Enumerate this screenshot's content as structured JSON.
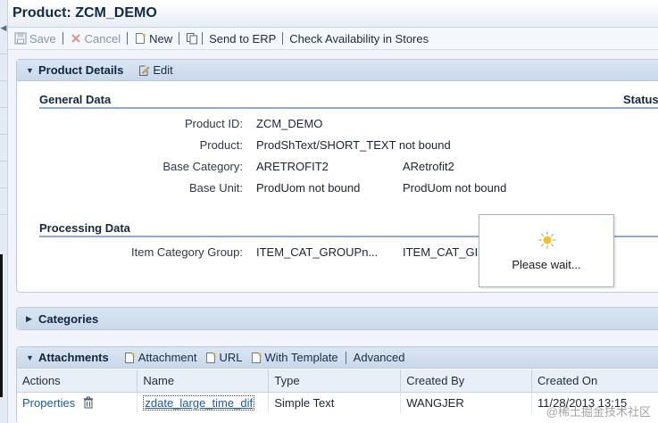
{
  "window": {
    "title": "Product: ZCM_DEMO"
  },
  "toolbar": {
    "save_label": "Save",
    "cancel_label": "Cancel",
    "new_label": "New",
    "send_label": "Send to ERP",
    "check_label": "Check Availability in Stores"
  },
  "product_details": {
    "title": "Product Details",
    "edit_label": "Edit",
    "general_title": "General Data",
    "status_title": "Status",
    "processing_title": "Processing Data",
    "fields": [
      {
        "label": "Product ID:",
        "value": "ZCM_DEMO",
        "value2": ""
      },
      {
        "label": "Product:",
        "value": "ProdShText/SHORT_TEXT not bound",
        "value2": ""
      },
      {
        "label": "Base Category:",
        "value": "ARETROFIT2",
        "value2": "ARetrofit2"
      },
      {
        "label": "Base Unit:",
        "value": "ProdUom not bound",
        "value2": "ProdUom not bound"
      }
    ],
    "processing_fields": [
      {
        "label": "Item Category Group:",
        "value": "ITEM_CAT_GROUPn...",
        "value2": "ITEM_CAT_GI"
      }
    ]
  },
  "popup": {
    "message": "Please wait..."
  },
  "categories": {
    "title": "Categories"
  },
  "attachments": {
    "title": "Attachments",
    "attachment_label": "Attachment",
    "url_label": "URL",
    "template_label": "With Template",
    "advanced_label": "Advanced",
    "columns": [
      "Actions",
      "Name",
      "Type",
      "Created By",
      "Created On"
    ],
    "rows": [
      {
        "action": "Properties",
        "name": "zdate_large_time_dif",
        "type": "Simple Text",
        "created_by": "WANGJER",
        "created_on": "11/28/2013 13:15"
      }
    ]
  },
  "watermark": "@稀土掘金技术社区",
  "colors": {
    "accent": "#1b5aa6",
    "panel_header": "#c9d8ea",
    "group_underline": "#8eabcc"
  }
}
